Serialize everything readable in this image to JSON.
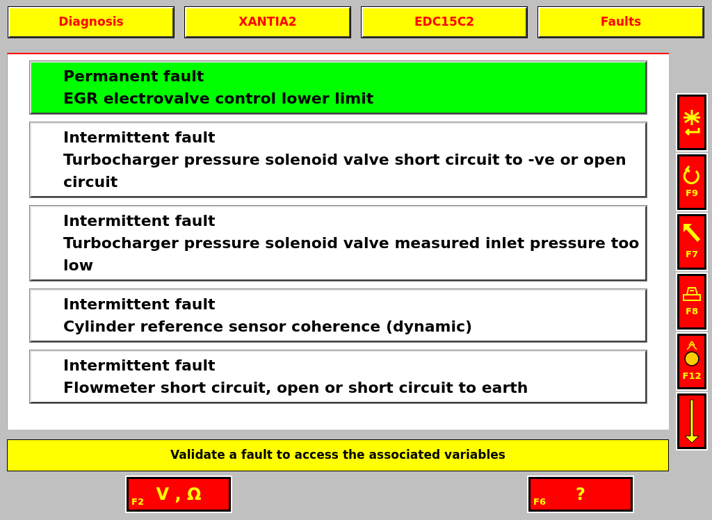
{
  "header": [
    "Diagnosis",
    "XANTIA2",
    "EDC15C2",
    "Faults"
  ],
  "faults": [
    {
      "title": "Permanent fault",
      "description": "EGR electrovalve control lower limit",
      "selected": true
    },
    {
      "title": "Intermittent fault",
      "description": "Turbocharger pressure solenoid valve short circuit to -ve or open circuit",
      "selected": false
    },
    {
      "title": "Intermittent fault",
      "description": "Turbocharger pressure solenoid valve measured inlet pressure too low",
      "selected": false
    },
    {
      "title": "Intermittent fault",
      "description": "Cylinder reference sensor coherence (dynamic)",
      "selected": false
    },
    {
      "title": "Intermittent fault",
      "description": "Flowmeter short circuit, open or short circuit to earth",
      "selected": false
    }
  ],
  "side_buttons": [
    {
      "kind": "validate"
    },
    {
      "kind": "undo",
      "key": "F9"
    },
    {
      "kind": "arrow",
      "key": "F7"
    },
    {
      "kind": "printer",
      "key": "F8"
    },
    {
      "kind": "globe",
      "key": "F12"
    },
    {
      "kind": "down"
    }
  ],
  "status": "Validate a fault to access the associated variables",
  "bottom_buttons": [
    {
      "key": "F2",
      "label": "V , Ω"
    },
    {
      "key": "F6",
      "label": "?"
    }
  ]
}
